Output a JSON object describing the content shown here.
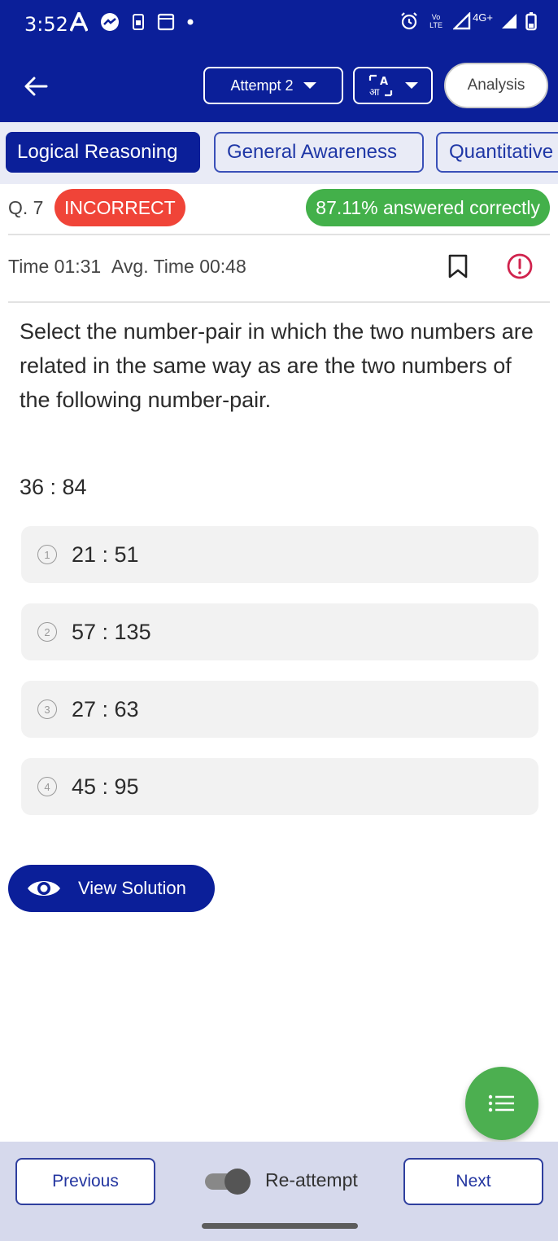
{
  "status_bar": {
    "time": "3:52",
    "network": "4G+",
    "volte": "Vo LTE"
  },
  "header": {
    "attempt_label": "Attempt 2",
    "language_icon": "translate-icon",
    "analysis_label": "Analysis"
  },
  "tabs": [
    {
      "label": "Logical Reasoning",
      "active": true
    },
    {
      "label": "General Awareness",
      "active": false
    },
    {
      "label": "Quantitative",
      "active": false
    }
  ],
  "question_meta": {
    "number": "Q. 7",
    "status": "INCORRECT",
    "percent_correct": "87.11% answered correctly",
    "time": "Time 01:31",
    "avg_time": "Avg. Time 00:48"
  },
  "question": {
    "text": "Select the number-pair in which the two numbers are related in the same way as are the two numbers of the following number-pair.",
    "pair": "36 : 84",
    "options": [
      {
        "num": "1",
        "text": "21 : 51"
      },
      {
        "num": "2",
        "text": "57 : 135"
      },
      {
        "num": "3",
        "text": "27 : 63"
      },
      {
        "num": "4",
        "text": "45 : 95"
      }
    ]
  },
  "actions": {
    "view_solution": "View Solution"
  },
  "footer": {
    "previous": "Previous",
    "reattempt": "Re-attempt",
    "next": "Next"
  },
  "colors": {
    "primary": "#0b1f99",
    "incorrect": "#f04438",
    "correct": "#43b04a",
    "fab": "#4caf50"
  }
}
